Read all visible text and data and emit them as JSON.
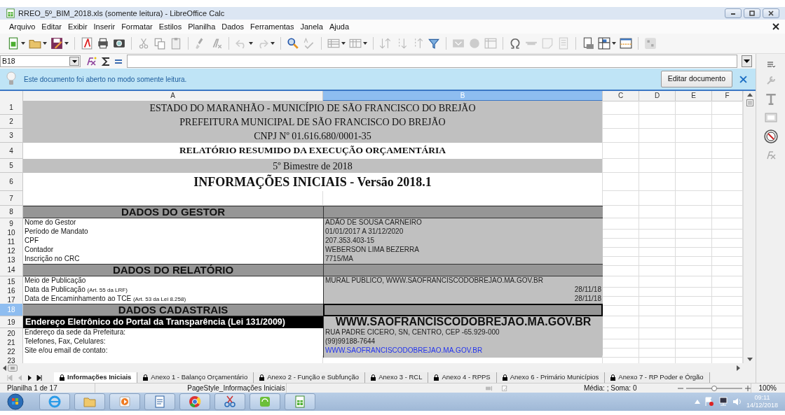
{
  "window": {
    "title": "RREO_5º_BIM_2018.xls (somente leitura) - LibreOffice Calc"
  },
  "menu": [
    "Arquivo",
    "Editar",
    "Exibir",
    "Inserir",
    "Formatar",
    "Estilos",
    "Planilha",
    "Dados",
    "Ferramentas",
    "Janela",
    "Ajuda"
  ],
  "formula_bar": {
    "cell_reference": "B18"
  },
  "infobar": {
    "message": "Este documento foi aberto no modo somente leitura.",
    "button": "Editar documento"
  },
  "columns": [
    {
      "label": "A",
      "selected": false
    },
    {
      "label": "B",
      "selected": true
    },
    {
      "label": "C",
      "selected": false
    },
    {
      "label": "D",
      "selected": false
    },
    {
      "label": "E",
      "selected": false
    },
    {
      "label": "F",
      "selected": false
    }
  ],
  "rows": [
    {
      "number": "1",
      "selected": false,
      "kind": "title",
      "shaded": true,
      "bold": false,
      "large": false,
      "text": "ESTADO DO MARANHÃO - MUNICÍPIO DE SÃO FRANCISCO DO BREJÃO"
    },
    {
      "number": "2",
      "selected": false,
      "kind": "title",
      "shaded": true,
      "bold": false,
      "large": false,
      "text": "PREFEITURA MUNICIPAL DE SÃO FRANCISCO DO BREJÃO"
    },
    {
      "number": "3",
      "selected": false,
      "kind": "title",
      "shaded": true,
      "bold": false,
      "large": false,
      "text": "CNPJ Nº 01.616.680/0001-35"
    },
    {
      "number": "4",
      "selected": false,
      "kind": "title",
      "shaded": false,
      "bold": true,
      "large": false,
      "text": "RELATÓRIO RESUMIDO DA EXECUÇÃO ORÇAMENTÁRIA"
    },
    {
      "number": "5",
      "selected": false,
      "kind": "title",
      "shaded": true,
      "bold": false,
      "large": false,
      "text": "5º Bimestre de 2018"
    },
    {
      "number": "6",
      "selected": false,
      "kind": "title",
      "shaded": false,
      "bold": true,
      "large": true,
      "text": "INFORMAÇÕES INICIAIS - Versão 2018.1"
    },
    {
      "number": "7",
      "selected": false,
      "kind": "empty"
    },
    {
      "number": "8",
      "selected": false,
      "kind": "section",
      "text": "DADOS DO GESTOR"
    },
    {
      "number": "9",
      "selected": false,
      "kind": "data",
      "label": "Nome do Gestor",
      "value": "ADÃO DE SOUSA CARNEIRO",
      "right_aligned": false,
      "link": false
    },
    {
      "number": "10",
      "selected": false,
      "kind": "data",
      "label": "Período de Mandato",
      "value": "01/01/2017 A 31/12/2020",
      "right_aligned": false,
      "link": false
    },
    {
      "number": "11",
      "selected": false,
      "kind": "data",
      "label": "CPF",
      "value": "207.353.403-15",
      "right_aligned": false,
      "link": false
    },
    {
      "number": "12",
      "selected": false,
      "kind": "data",
      "label": "Contador",
      "value": "WEBERSON LIMA BEZERRA",
      "right_aligned": false,
      "link": false
    },
    {
      "number": "13",
      "selected": false,
      "kind": "data",
      "label": "Inscrição no CRC",
      "value": "7715/MA",
      "right_aligned": false,
      "link": false
    },
    {
      "number": "14",
      "selected": false,
      "kind": "section",
      "text": "DADOS DO RELATÓRIO"
    },
    {
      "number": "15",
      "selected": false,
      "kind": "data",
      "label": "Meio de Publicação",
      "value": "MURAL PUBLICO, WWW.SAOFRANCISCODOBREJAO.MA.GOV.BR",
      "right_aligned": false,
      "link": false
    },
    {
      "number": "16",
      "selected": false,
      "kind": "data",
      "label": "Data da Publicação",
      "note": "(Art. 55 da LRF)",
      "value": "28/11/18",
      "right_aligned": true,
      "link": false
    },
    {
      "number": "17",
      "selected": false,
      "kind": "data",
      "label": "Data de Encaminhamento ao TCE",
      "note": "(Art. 53 da Lei 8.258)",
      "value": "28/11/18",
      "right_aligned": true,
      "link": false
    },
    {
      "number": "18",
      "selected": true,
      "kind": "section",
      "text": "DADOS CADASTRAIS"
    },
    {
      "number": "19",
      "selected": false,
      "kind": "highlight",
      "label": "Endereço Eletrônico do Portal da Transparência (Lei 131/2009)",
      "value": "WWW.SAOFRANCISCODOBREJAO.MA.GOV.BR"
    },
    {
      "number": "20",
      "selected": false,
      "kind": "data",
      "label": "Endereço da sede da Prefeitura:",
      "value": "RUA PADRE CICERO, SN, CENTRO, CEP -65.929-000",
      "right_aligned": false,
      "link": false
    },
    {
      "number": "21",
      "selected": false,
      "kind": "data",
      "label": "Telefones, Fax, Celulares:",
      "value": "(99)99188-7644",
      "right_aligned": false,
      "link": false
    },
    {
      "number": "22",
      "selected": false,
      "kind": "data",
      "label": "Site e/ou email de contato:",
      "value": "WWW.SAOFRANCISCODOBREJAO.MA.GOV.BR",
      "right_aligned": false,
      "link": true
    },
    {
      "number": "23",
      "selected": false,
      "kind": "empty"
    }
  ],
  "sheet_tabs": [
    {
      "label": "Informações Iniciais",
      "selected": true
    },
    {
      "label": "Anexo 1 - Balanço Orçamentário",
      "selected": false
    },
    {
      "label": "Anexo 2 - Função e Subfunção",
      "selected": false
    },
    {
      "label": "Anexo 3 - RCL",
      "selected": false
    },
    {
      "label": "Anexo 4 - RPPS",
      "selected": false
    },
    {
      "label": "Anexo 6 - Primário Municípios",
      "selected": false
    },
    {
      "label": "Anexo 7 - RP Poder e Órgão",
      "selected": false
    }
  ],
  "status_bar": {
    "sheet": "Planilha 1 de 17",
    "page_style": "PageStyle_Informações Iniciais",
    "summary": "Média: ; Soma: 0",
    "zoom_slider": {
      "level": 0.5
    },
    "zoom": "100%"
  },
  "taskbar": {
    "time": "09:11",
    "date": "14/12/2018"
  }
}
